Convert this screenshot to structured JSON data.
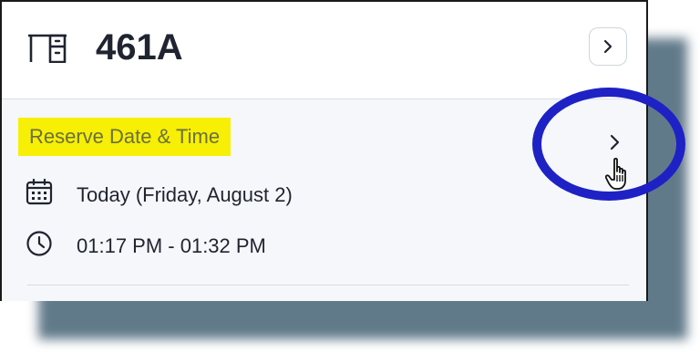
{
  "header": {
    "title": "461A",
    "desk_icon": "desk-icon",
    "open_icon": "chevron-right-icon"
  },
  "reserve": {
    "label": "Reserve Date & Time",
    "highlight_color": "#f7ef05",
    "date_icon": "calendar-icon",
    "date_text": "Today (Friday, August 2)",
    "time_icon": "clock-icon",
    "time_text": "01:17 PM - 01:32 PM",
    "open_icon": "chevron-right-icon"
  },
  "annotation": {
    "ring_color": "#1e22c4",
    "cursor_icon": "hand-pointer-icon"
  }
}
